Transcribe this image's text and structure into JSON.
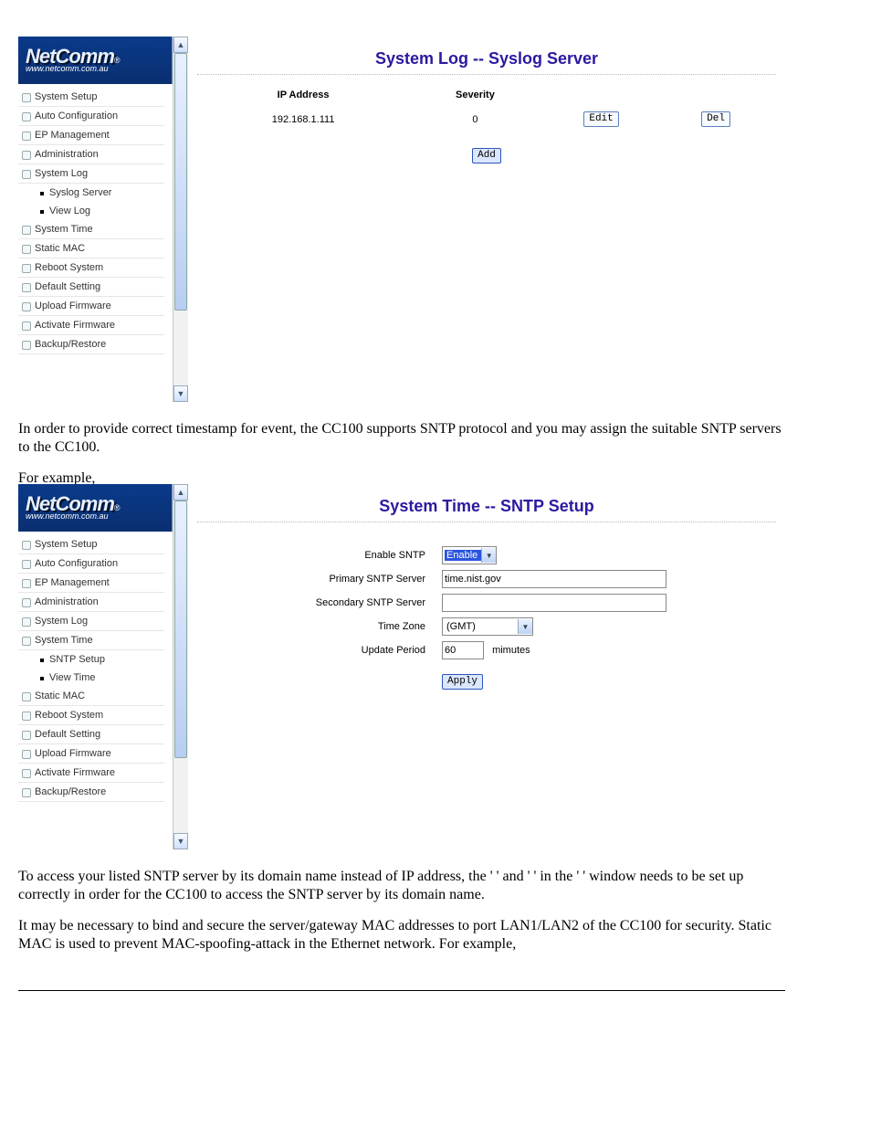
{
  "logo": {
    "brand": "NetComm",
    "reg": "®",
    "url": "www.netcomm.com.au"
  },
  "shot1": {
    "title": "System Log -- Syslog Server",
    "sidebar": [
      "System Setup",
      "Auto Configuration",
      "EP Management",
      "Administration",
      "System Log"
    ],
    "sidebar_sub": [
      "Syslog Server",
      "View Log"
    ],
    "sidebar2": [
      "System Time",
      "Static MAC",
      "Reboot System",
      "Default Setting",
      "Upload Firmware",
      "Activate Firmware",
      "Backup/Restore"
    ],
    "table": {
      "headers": {
        "ip": "IP Address",
        "sev": "Severity"
      },
      "row": {
        "ip": "192.168.1.111",
        "sev": "0"
      },
      "edit": "Edit",
      "del": "Del",
      "add": "Add"
    }
  },
  "para1": "In order to provide correct timestamp for event, the CC100 supports SNTP protocol and you may assign the suitable SNTP servers to the CC100.",
  "for_example": "For example,",
  "shot2": {
    "title": "System Time -- SNTP Setup",
    "sidebar": [
      "System Setup",
      "Auto Configuration",
      "EP Management",
      "Administration",
      "System Log",
      "System Time"
    ],
    "sidebar_sub": [
      "SNTP Setup",
      "View Time"
    ],
    "sidebar2": [
      "Static MAC",
      "Reboot System",
      "Default Setting",
      "Upload Firmware",
      "Activate Firmware",
      "Backup/Restore"
    ],
    "form": {
      "enable_label": "Enable SNTP",
      "enable_value": "Enable",
      "primary_label": "Primary SNTP Server",
      "primary_value": "time.nist.gov",
      "secondary_label": "Secondary SNTP Server",
      "secondary_value": "",
      "tz_label": "Time Zone",
      "tz_value": "(GMT)",
      "period_label": "Update Period",
      "period_value": "60",
      "period_suffix": "mimutes",
      "apply": "Apply"
    }
  },
  "para2_a": "To access your listed SNTP server by its domain name instead of IP address, the '",
  "para2_b": "' and '",
  "para2_c": "' in the '",
  "para2_d": "' window needs to be set up correctly in order for the CC100 to access the SNTP server by its domain name.",
  "para3": "It may be necessary to bind and secure the server/gateway MAC addresses to port LAN1/LAN2 of the CC100 for security. Static MAC is used to prevent MAC-spoofing-attack in the Ethernet network. For example,"
}
